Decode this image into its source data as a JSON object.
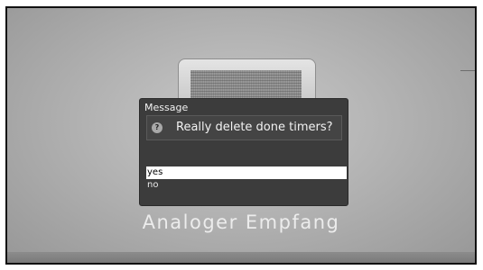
{
  "dialog": {
    "title": "Message",
    "question_icon": "?",
    "question": "Really delete done timers?",
    "options": [
      "yes",
      "no"
    ],
    "selected": "yes"
  },
  "background": {
    "caption": "Analoger Empfang",
    "image": "tv-icon"
  }
}
